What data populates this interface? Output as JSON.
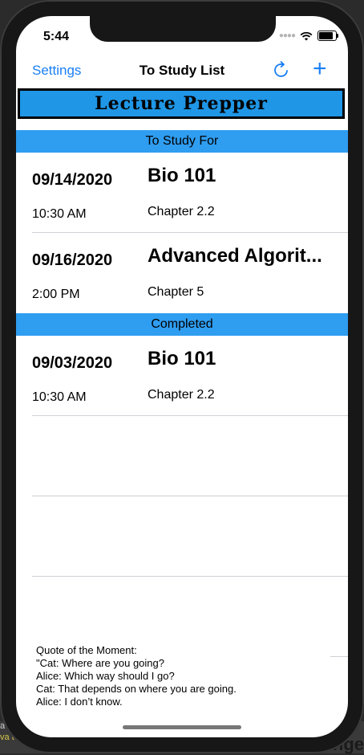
{
  "background": {
    "line1": "a",
    "line2": "va t",
    "line3": "ange"
  },
  "status_bar": {
    "time": "5:44"
  },
  "nav": {
    "left_label": "Settings",
    "title": "To Study List",
    "refresh_icon": "refresh-icon",
    "add_label": "+"
  },
  "banner": {
    "text": "Lecture Prepper"
  },
  "sections": [
    {
      "header": "To Study For",
      "rows": [
        {
          "date": "09/14/2020",
          "title": "Bio 101",
          "time": "10:30 AM",
          "chapter": "Chapter 2.2"
        },
        {
          "date": "09/16/2020",
          "title": "Advanced Algorit...",
          "time": "2:00 PM",
          "chapter": "Chapter 5"
        }
      ]
    },
    {
      "header": "Completed",
      "rows": [
        {
          "date": "09/03/2020",
          "title": "Bio 101",
          "time": "10:30 AM",
          "chapter": "Chapter 2.2"
        }
      ]
    }
  ],
  "quote": {
    "heading": "Quote of the Moment:",
    "lines": [
      "\"Cat: Where are you going?",
      "Alice: Which way should I go?",
      "Cat: That depends on where you are going.",
      "Alice: I don’t know."
    ]
  },
  "colors": {
    "accent": "#1a7ff5",
    "section_header": "#2f9df0",
    "banner": "#1f96e6"
  }
}
